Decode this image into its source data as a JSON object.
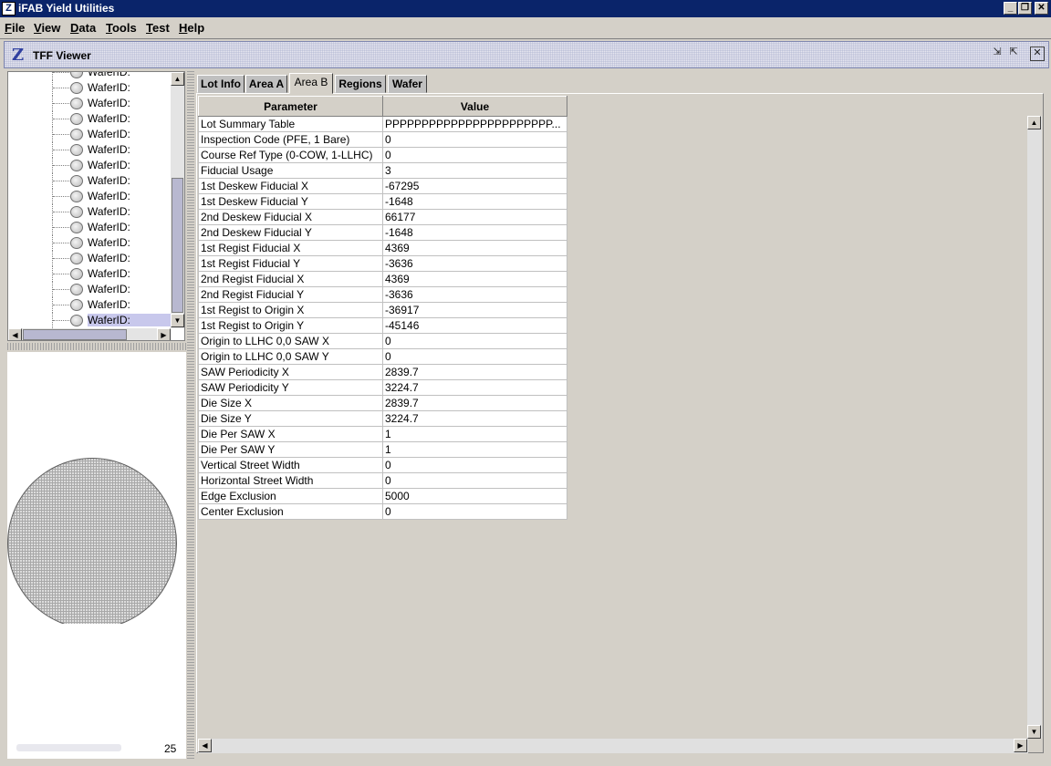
{
  "window": {
    "title": "iFAB Yield Utilities"
  },
  "menu": [
    "File",
    "View",
    "Data",
    "Tools",
    "Test",
    "Help"
  ],
  "menu_underline": [
    "F",
    "V",
    "D",
    "T",
    "T",
    "H"
  ],
  "frame": {
    "title": "TFF Viewer"
  },
  "tree": {
    "partial_label": "WaferID:",
    "items": [
      "WaferID:",
      "WaferID:",
      "WaferID:",
      "WaferID:",
      "WaferID:",
      "WaferID:",
      "WaferID:",
      "WaferID:",
      "WaferID:",
      "WaferID:",
      "WaferID:",
      "WaferID:",
      "WaferID:",
      "WaferID:",
      "WaferID:",
      "WaferID:"
    ],
    "selected_index": 15
  },
  "wafer_pane": {
    "count": "25"
  },
  "tabs": [
    "Lot Info",
    "Area A",
    "Area B",
    "Regions",
    "Wafer"
  ],
  "active_tab": 2,
  "table": {
    "headers": [
      "Parameter",
      "Value"
    ],
    "rows": [
      [
        "Lot Summary Table",
        "PPPPPPPPPPPPPPPPPPPPPPP..."
      ],
      [
        "Inspection Code (PFE, 1 Bare)",
        "0"
      ],
      [
        "Course Ref Type (0-COW, 1-LLHC)",
        "0"
      ],
      [
        "Fiducial Usage",
        "3"
      ],
      [
        "1st Deskew Fiducial X",
        "-67295"
      ],
      [
        "1st Deskew Fiducial Y",
        "-1648"
      ],
      [
        "2nd Deskew Fiducial X",
        "66177"
      ],
      [
        "2nd Deskew Fiducial Y",
        "-1648"
      ],
      [
        "1st Regist Fiducial X",
        "4369"
      ],
      [
        "1st Regist Fiducial Y",
        "-3636"
      ],
      [
        "2nd Regist Fiducial X",
        "4369"
      ],
      [
        "2nd Regist Fiducial Y",
        "-3636"
      ],
      [
        "1st Regist to Origin X",
        "-36917"
      ],
      [
        "1st Regist to Origin Y",
        "-45146"
      ],
      [
        "Origin to LLHC 0,0 SAW X",
        "0"
      ],
      [
        "Origin to LLHC 0,0 SAW Y",
        "0"
      ],
      [
        "SAW Periodicity X",
        "2839.7"
      ],
      [
        "SAW Periodicity Y",
        "3224.7"
      ],
      [
        "Die Size X",
        "2839.7"
      ],
      [
        "Die Size Y",
        "3224.7"
      ],
      [
        "Die Per SAW X",
        "1"
      ],
      [
        "Die Per SAW Y",
        "1"
      ],
      [
        "Vertical Street Width",
        "0"
      ],
      [
        "Horizontal Street Width",
        "0"
      ],
      [
        "Edge Exclusion",
        "5000"
      ],
      [
        "Center Exclusion",
        "0"
      ]
    ]
  },
  "colors": {
    "titlebar": "#0a246a",
    "selection": "#c8c8ec",
    "panel": "#d4d0c8"
  },
  "icons": [
    "app-logo-icon",
    "minimize-icon",
    "restore-icon",
    "close-icon",
    "z-logo-icon",
    "frame-minimize-icon",
    "frame-maximize-icon",
    "frame-close-icon",
    "wafer-disc-icon",
    "scroll-up-icon",
    "scroll-down-icon",
    "scroll-left-icon",
    "scroll-right-icon"
  ]
}
